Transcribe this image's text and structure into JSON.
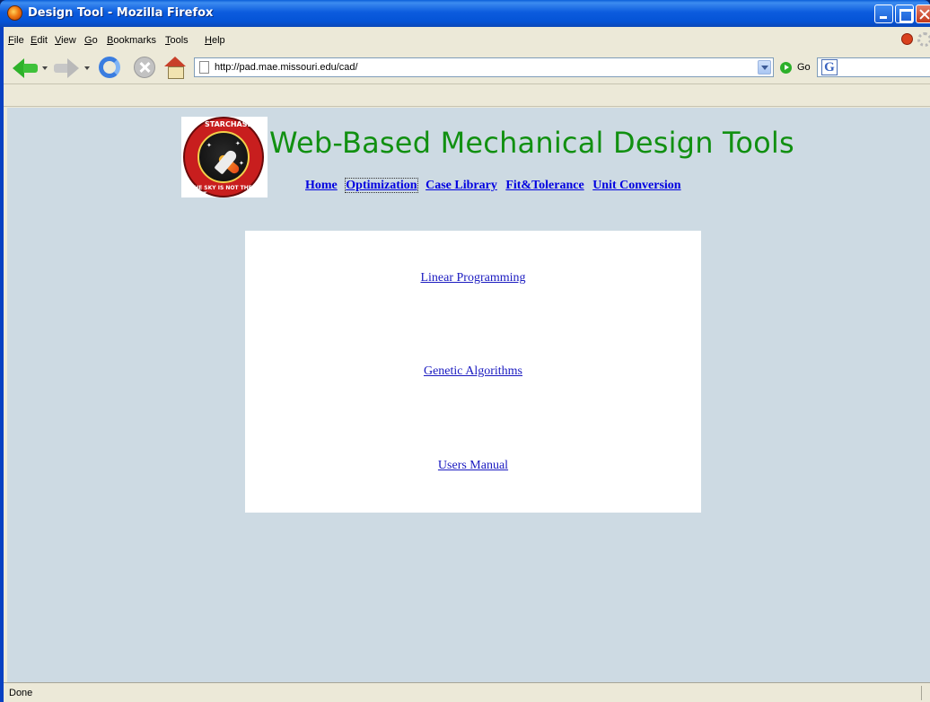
{
  "window": {
    "title": "Design Tool - Mozilla Firefox"
  },
  "menubar": {
    "items": [
      {
        "label": "File",
        "accel": "F",
        "rest": "ile"
      },
      {
        "label": "Edit",
        "accel": "E",
        "rest": "dit"
      },
      {
        "label": "View",
        "accel": "V",
        "rest": "iew"
      },
      {
        "label": "Go",
        "accel": "G",
        "rest": "o"
      },
      {
        "label": "Bookmarks",
        "accel": "B",
        "rest": "ookmarks"
      },
      {
        "label": "Tools",
        "accel": "T",
        "rest": "ools"
      },
      {
        "label": "Help",
        "accel": "H",
        "rest": "elp"
      }
    ]
  },
  "toolbar": {
    "url": "http://pad.mae.missouri.edu/cad/",
    "go_label": "Go",
    "search_engine_letter": "G"
  },
  "page": {
    "site_title": "Web-Based Mechanical Design Tools",
    "logo": {
      "top_text": "STARCHASER",
      "bottom_text": "THE SKY IS NOT THE LIMIT"
    },
    "nav": [
      {
        "label": "Home",
        "current": false
      },
      {
        "label": "Optimization",
        "current": true
      },
      {
        "label": "Case Library",
        "current": false
      },
      {
        "label": "Fit&Tolerance",
        "current": false
      },
      {
        "label": "Unit Conversion",
        "current": false
      }
    ],
    "panel_links": [
      {
        "label": "Linear Programming"
      },
      {
        "label": "Genetic Algorithms"
      },
      {
        "label": "Users Manual"
      }
    ]
  },
  "statusbar": {
    "text": "Done"
  },
  "colors": {
    "title_bar": "#0c5cde",
    "page_background": "#cddae3",
    "site_title": "#119011",
    "nav_link": "#0000e0",
    "panel_link": "#1a1ac0"
  }
}
